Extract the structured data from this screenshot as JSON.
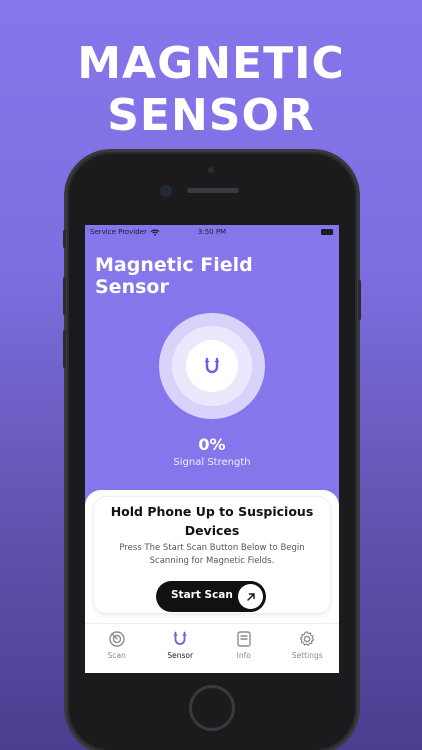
{
  "headline": {
    "line1": "MAGNETIC",
    "line2": "SENSOR"
  },
  "status_bar": {
    "carrier": "Service Provider",
    "time": "3:50 PM"
  },
  "screen": {
    "title_line1": "Magnetic Field",
    "title_line2": "Sensor",
    "signal_value": "0%",
    "signal_label": "Signal Strength"
  },
  "card": {
    "title_line1": "Hold Phone Up to Suspicious",
    "title_line2": "Devices",
    "desc_line1": "Press The Start Scan Button Below to Begin",
    "desc_line2": "Scanning for Magnetic Fields.",
    "button_label": "Start Scan"
  },
  "tabs": [
    {
      "label": "Scan",
      "icon": "radar-icon",
      "active": false
    },
    {
      "label": "Sensor",
      "icon": "magnet-icon",
      "active": true
    },
    {
      "label": "Info",
      "icon": "book-icon",
      "active": false
    },
    {
      "label": "Settings",
      "icon": "gear-icon",
      "active": false
    }
  ],
  "colors": {
    "background": "#8676ec",
    "accent": "#6f5fe0",
    "ring_outer": "#d9d3fb",
    "ring_middle": "#ebe8fd",
    "button": "#111114"
  }
}
